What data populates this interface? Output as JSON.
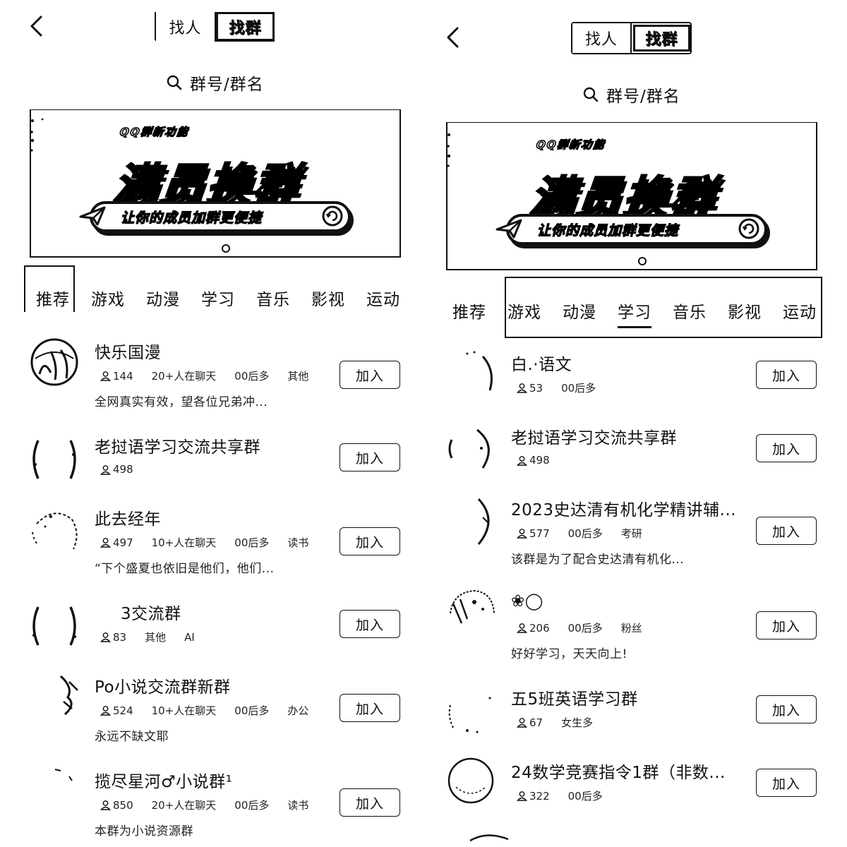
{
  "left": {
    "switch": {
      "people_label": "找人",
      "groups_label": "找群"
    },
    "search": {
      "placeholder": "群号/群名"
    },
    "banner": {
      "subtitle": "QQ群新功能",
      "title": "满员换群",
      "slogan": "让你的成员加群更便捷"
    },
    "tabs": [
      "推荐",
      "游戏",
      "动漫",
      "学习",
      "音乐",
      "影视",
      "运动"
    ],
    "active_tab": "推荐",
    "join_label": "加入",
    "groups": [
      {
        "name": "快乐国漫",
        "members": "144",
        "tags": [
          "20+人在聊天",
          "00后多",
          "其他"
        ],
        "desc": "全网真实有效，望各位兄弟冲..."
      },
      {
        "name": "老挝语学习交流共享群",
        "members": "498",
        "tags": [],
        "desc": ""
      },
      {
        "name": "此去经年",
        "members": "497",
        "tags": [
          "10+人在聊天",
          "00后多",
          "读书"
        ],
        "desc": "“下个盛夏也依旧是他们，他们..."
      },
      {
        "name": "3交流群",
        "members": "83",
        "tags": [
          "其他",
          "AI"
        ],
        "desc": ""
      },
      {
        "name": "Po小说交流群新群",
        "members": "524",
        "tags": [
          "10+人在聊天",
          "00后多",
          "办公"
        ],
        "desc": "永远不缺文耶"
      },
      {
        "name": "揽尽星河♂小说群¹",
        "members": "850",
        "tags": [
          "20+人在聊天",
          "00后多",
          "读书"
        ],
        "desc": "本群为小说资源群"
      }
    ]
  },
  "right": {
    "switch": {
      "people_label": "找人",
      "groups_label": "找群"
    },
    "search": {
      "placeholder": "群号/群名"
    },
    "banner": {
      "subtitle": "QQ群新功能",
      "title": "满员换群",
      "slogan": "让你的成员加群更便捷"
    },
    "tabs": [
      "推荐",
      "游戏",
      "动漫",
      "学习",
      "音乐",
      "影视",
      "运动"
    ],
    "active_tab": "学习",
    "join_label": "加入",
    "groups": [
      {
        "name": "白.·语文",
        "members": "53",
        "tags": [
          "00后多"
        ],
        "desc": ""
      },
      {
        "name": "老挝语学习交流共享群",
        "members": "498",
        "tags": [],
        "desc": ""
      },
      {
        "name": "2023史达清有机化学精讲辅...",
        "members": "577",
        "tags": [
          "00后多",
          "考研"
        ],
        "desc": "该群是为了配合史达清有机化..."
      },
      {
        "name": "❀◯",
        "members": "206",
        "tags": [
          "00后多",
          "粉丝"
        ],
        "desc": "好好学习，天天向上!"
      },
      {
        "name": "五5班英语学习群",
        "members": "67",
        "tags": [
          "女生多"
        ],
        "desc": ""
      },
      {
        "name": "24数学竞赛指令1群（非数...",
        "members": "322",
        "tags": [
          "00后多"
        ],
        "desc": ""
      }
    ]
  },
  "colors": {
    "ink": "#111111",
    "background": "#ffffff"
  },
  "icons": {
    "back": "chevron-left-icon",
    "search": "magnifier-icon",
    "members": "person-icon",
    "banner_plane": "paper-plane-icon",
    "banner_refresh": "refresh-icon"
  }
}
